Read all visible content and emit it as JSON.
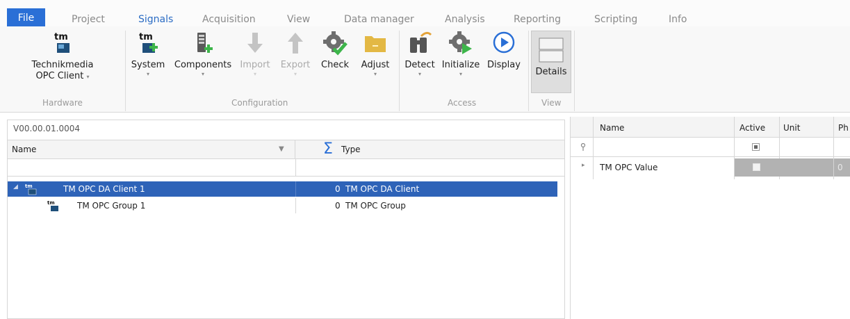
{
  "tabs": {
    "file": "File",
    "items": [
      "Project",
      "Signals",
      "Acquisition",
      "View",
      "Data manager",
      "Analysis",
      "Reporting",
      "Scripting",
      "Info"
    ]
  },
  "ribbon": {
    "hardware": {
      "logo_text": "tm",
      "client_line1": "Technikmedia",
      "client_line2": "OPC Client",
      "label": "Hardware"
    },
    "configuration": {
      "system_logo_text": "tm",
      "system": "System",
      "components": "Components",
      "import": "Import",
      "export": "Export",
      "check": "Check",
      "adjust": "Adjust",
      "label": "Configuration"
    },
    "access": {
      "detect": "Detect",
      "initialize": "Initialize",
      "display": "Display",
      "label": "Access"
    },
    "view": {
      "details": "Details",
      "label": "View"
    }
  },
  "left_panel": {
    "version": "V00.00.01.0004",
    "col_name": "Name",
    "col_type": "Type",
    "rows": [
      {
        "name": "TM OPC DA Client 1",
        "count": "0",
        "type": "TM OPC DA Client",
        "selected": true
      },
      {
        "name": "TM OPC Group 1",
        "count": "0",
        "type": "TM OPC Group",
        "selected": false
      }
    ]
  },
  "right_panel": {
    "columns": [
      "Name",
      "Active",
      "Unit",
      "Ph"
    ],
    "rows": [
      {
        "name": "TM OPC Value",
        "value_stub": "0"
      }
    ]
  },
  "colors": {
    "accent": "#2a6fd6",
    "selection": "#2e63b8"
  },
  "icons": [
    "tm-logo-icon",
    "components-icon",
    "import-arrow-icon",
    "export-arrow-icon",
    "check-gear-icon",
    "adjust-folder-icon",
    "detect-binoculars-icon",
    "initialize-gear-icon",
    "display-play-icon",
    "details-icon",
    "sum-icon",
    "filter-icon"
  ]
}
